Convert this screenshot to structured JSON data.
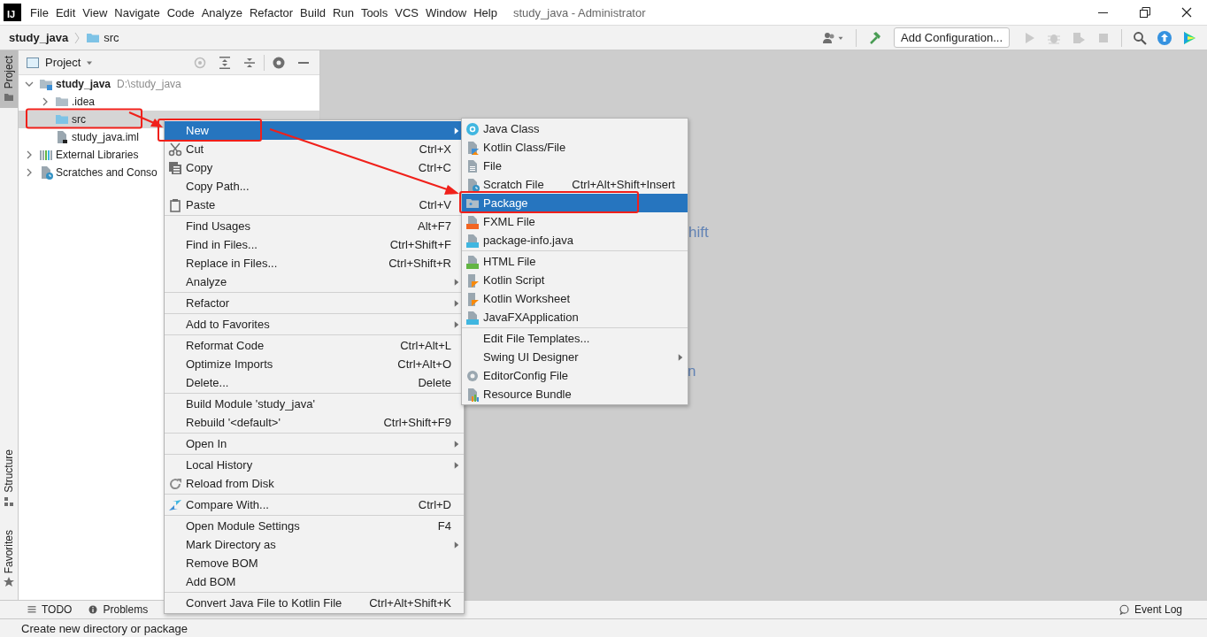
{
  "app_logo": "IJ",
  "menu_bar": [
    "File",
    "Edit",
    "View",
    "Navigate",
    "Code",
    "Analyze",
    "Refactor",
    "Build",
    "Run",
    "Tools",
    "VCS",
    "Window",
    "Help"
  ],
  "window": {
    "title": "study_java - Administrator"
  },
  "breadcrumbs": [
    "study_java",
    "src"
  ],
  "toolbar": {
    "run_config_button": "Add Configuration..."
  },
  "left_stripe": {
    "top": [
      {
        "label": "Project",
        "selected": true
      }
    ],
    "bottom": [
      {
        "label": "Structure",
        "selected": false
      },
      {
        "label": "Favorites",
        "selected": false
      }
    ]
  },
  "project_panel": {
    "title": "Project",
    "tree": [
      {
        "label": "study_java",
        "kind": "module",
        "note": "D:\\study_java",
        "expanded": true,
        "selected": false,
        "children": [
          {
            "label": ".idea",
            "kind": "folder",
            "expanded": false,
            "selected": false
          },
          {
            "label": "src",
            "kind": "source_folder",
            "selected": true
          },
          {
            "label": "study_java.iml",
            "kind": "module_file",
            "selected": false
          }
        ]
      },
      {
        "label": "External Libraries",
        "kind": "libraries",
        "expanded": false,
        "selected": false
      },
      {
        "label": "Scratches and Conso",
        "kind": "scratches",
        "expanded": false,
        "selected": false
      }
    ]
  },
  "editor_hints": [
    "hift",
    "n"
  ],
  "context_menu": {
    "groups": [
      [
        {
          "label": "New",
          "submenu": true,
          "selected": true
        },
        {
          "label": "Cut",
          "shortcut": "Ctrl+X",
          "submenu": false,
          "selected": false
        },
        {
          "label": "Copy",
          "shortcut": "Ctrl+C",
          "submenu": false,
          "selected": false
        },
        {
          "label": "Copy Path...",
          "submenu": false,
          "selected": false
        },
        {
          "label": "Paste",
          "shortcut": "Ctrl+V",
          "submenu": false,
          "selected": false
        }
      ],
      [
        {
          "label": "Find Usages",
          "shortcut": "Alt+F7",
          "submenu": false,
          "selected": false
        },
        {
          "label": "Find in Files...",
          "shortcut": "Ctrl+Shift+F",
          "submenu": false,
          "selected": false
        },
        {
          "label": "Replace in Files...",
          "shortcut": "Ctrl+Shift+R",
          "submenu": false,
          "selected": false
        },
        {
          "label": "Analyze",
          "submenu": true,
          "selected": false
        }
      ],
      [
        {
          "label": "Refactor",
          "submenu": true,
          "selected": false
        }
      ],
      [
        {
          "label": "Add to Favorites",
          "submenu": true,
          "selected": false
        }
      ],
      [
        {
          "label": "Reformat Code",
          "shortcut": "Ctrl+Alt+L",
          "submenu": false,
          "selected": false
        },
        {
          "label": "Optimize Imports",
          "shortcut": "Ctrl+Alt+O",
          "submenu": false,
          "selected": false
        },
        {
          "label": "Delete...",
          "shortcut": "Delete",
          "submenu": false,
          "selected": false
        }
      ],
      [
        {
          "label": "Build Module 'study_java'",
          "submenu": false,
          "selected": false
        },
        {
          "label": "Rebuild '<default>'",
          "shortcut": "Ctrl+Shift+F9",
          "submenu": false,
          "selected": false
        }
      ],
      [
        {
          "label": "Open In",
          "submenu": true,
          "selected": false
        }
      ],
      [
        {
          "label": "Local History",
          "submenu": true,
          "selected": false
        },
        {
          "label": "Reload from Disk",
          "submenu": false,
          "selected": false
        }
      ],
      [
        {
          "label": "Compare With...",
          "shortcut": "Ctrl+D",
          "submenu": false,
          "selected": false
        }
      ],
      [
        {
          "label": "Open Module Settings",
          "shortcut": "F4",
          "submenu": false,
          "selected": false
        },
        {
          "label": "Mark Directory as",
          "submenu": true,
          "selected": false
        },
        {
          "label": "Remove BOM",
          "submenu": false,
          "selected": false
        },
        {
          "label": "Add BOM",
          "submenu": false,
          "selected": false
        }
      ],
      [
        {
          "label": "Convert Java File to Kotlin File",
          "shortcut": "Ctrl+Alt+Shift+K",
          "submenu": false,
          "selected": false
        }
      ]
    ]
  },
  "new_submenu": {
    "groups": [
      [
        {
          "label": "Java Class",
          "submenu": false,
          "selected": false
        },
        {
          "label": "Kotlin Class/File",
          "submenu": false,
          "selected": false
        },
        {
          "label": "File",
          "submenu": false,
          "selected": false
        },
        {
          "label": "Scratch File",
          "shortcut": "Ctrl+Alt+Shift+Insert",
          "submenu": false,
          "selected": false
        },
        {
          "label": "Package",
          "submenu": false,
          "selected": true
        },
        {
          "label": "FXML File",
          "submenu": false,
          "selected": false
        },
        {
          "label": "package-info.java",
          "submenu": false,
          "selected": false
        }
      ],
      [
        {
          "label": "HTML File",
          "submenu": false,
          "selected": false
        },
        {
          "label": "Kotlin Script",
          "submenu": false,
          "selected": false
        },
        {
          "label": "Kotlin Worksheet",
          "submenu": false,
          "selected": false
        },
        {
          "label": "JavaFXApplication",
          "submenu": false,
          "selected": false
        }
      ],
      [
        {
          "label": "Edit File Templates...",
          "submenu": false,
          "selected": false
        },
        {
          "label": "Swing UI Designer",
          "submenu": true,
          "selected": false
        },
        {
          "label": "EditorConfig File",
          "submenu": false,
          "selected": false
        },
        {
          "label": "Resource Bundle",
          "submenu": false,
          "selected": false
        }
      ]
    ]
  },
  "tool_window_bar": {
    "left": [
      "TODO",
      "Problems"
    ],
    "right": [
      "Event Log"
    ]
  },
  "status_bar": "Create new directory or package"
}
